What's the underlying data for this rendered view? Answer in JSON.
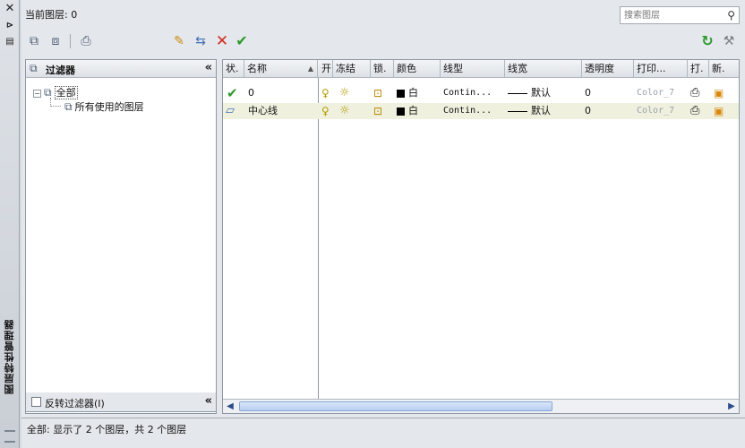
{
  "window": {
    "title": "图层特性管理器"
  },
  "current_layer": {
    "text": "当前图层: 0"
  },
  "search": {
    "placeholder": "搜索图层"
  },
  "filter_tree": {
    "header": "过滤器",
    "nodes": [
      {
        "label": "全部",
        "selected": true
      },
      {
        "label": "所有使用的图层"
      }
    ],
    "invert_label": "反转过滤器(I)"
  },
  "columns": [
    "状.",
    "名称",
    "开",
    "冻结",
    "锁.",
    "颜色",
    "线型",
    "线宽",
    "透明度",
    "打印...",
    "打.",
    "新."
  ],
  "layers": [
    {
      "status_icon": "check-icon",
      "name": "0",
      "on": "bulb-icon",
      "freeze": "sun-icon",
      "lock": "unlock-icon",
      "color_name": "白",
      "linetype": "Contin...",
      "lineweight": "默认",
      "transparency": "0",
      "plot_style": "Color_7"
    },
    {
      "status_icon": "layer-icon",
      "name": "中心线",
      "on": "bulb-icon",
      "freeze": "sun-icon",
      "lock": "unlock-icon",
      "color_name": "白",
      "linetype": "Contin...",
      "lineweight": "默认",
      "transparency": "0",
      "plot_style": "Color_7"
    }
  ],
  "status": {
    "text": "全部: 显示了 2 个图层，共 2 个图层"
  },
  "colors": {
    "accent_check": "#2a9a2a",
    "delete_red": "#d22a1e",
    "selection_row": "#eff1de"
  }
}
